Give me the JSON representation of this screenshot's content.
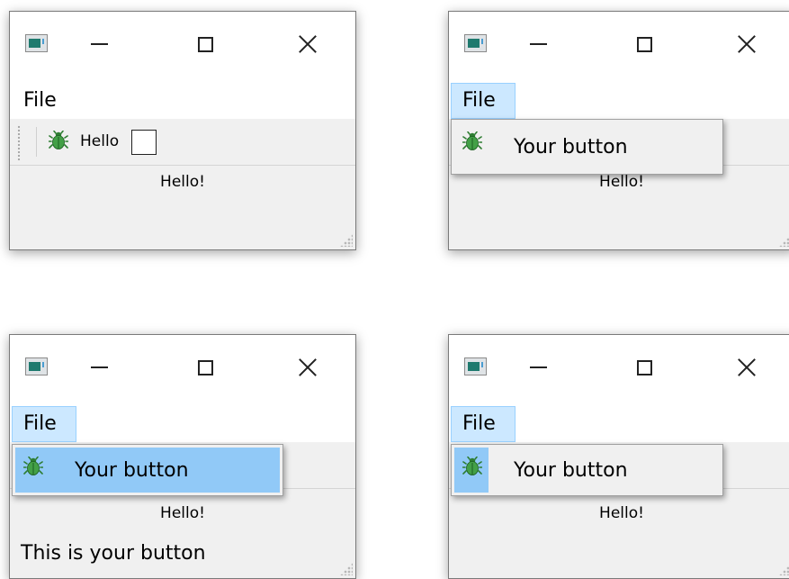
{
  "menu": {
    "file_label": "File"
  },
  "toolbar": {
    "hello_label": "Hello"
  },
  "central": {
    "text": "Hello!"
  },
  "popup": {
    "button_label": "Your button"
  },
  "statusbar": {
    "message": "This is your button"
  },
  "colors": {
    "menu_active_bg": "#cce8ff",
    "menu_highlight_bg": "#91c9f7",
    "window_bg": "#f0f0f0"
  },
  "icons": {
    "app": "app-window-icon",
    "minimize": "minimize-icon",
    "maximize": "maximize-icon",
    "close": "close-icon",
    "bug": "bug-icon"
  }
}
